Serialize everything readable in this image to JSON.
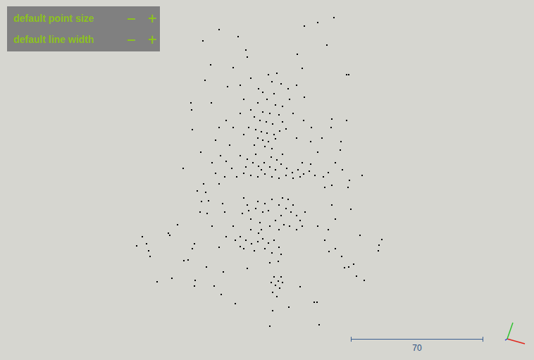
{
  "panel": {
    "rows": [
      {
        "label": "default point size",
        "decrease": "−",
        "increase": "+"
      },
      {
        "label": "default line width",
        "decrease": "−",
        "increase": "+"
      }
    ]
  },
  "scale_bar": {
    "label": "70"
  },
  "axes": [
    {
      "color": "#e0261c"
    },
    {
      "color": "#2fc22f"
    },
    {
      "color": "#2a40d0"
    }
  ],
  "point_cloud": {
    "points": [
      [
        473,
        24
      ],
      [
        450,
        31
      ],
      [
        431,
        36
      ],
      [
        310,
        41
      ],
      [
        337,
        51
      ],
      [
        287,
        57
      ],
      [
        463,
        63
      ],
      [
        348,
        70
      ],
      [
        421,
        76
      ],
      [
        350,
        80
      ],
      [
        491,
        105
      ],
      [
        494,
        105
      ],
      [
        270,
        145
      ],
      [
        271,
        155
      ],
      [
        272,
        183
      ],
      [
        259,
        238
      ],
      [
        193,
        348
      ],
      [
        201,
        335
      ],
      [
        207,
        345
      ],
      [
        210,
        355
      ],
      [
        212,
        363
      ],
      [
        222,
        399
      ],
      [
        243,
        394
      ],
      [
        238,
        330
      ],
      [
        251,
        318
      ],
      [
        240,
        333
      ],
      [
        275,
        345
      ],
      [
        272,
        352
      ],
      [
        260,
        369
      ],
      [
        266,
        368
      ],
      [
        276,
        397
      ],
      [
        275,
        405
      ],
      [
        292,
        378
      ],
      [
        303,
        405
      ],
      [
        313,
        417
      ],
      [
        316,
        385
      ],
      [
        333,
        430
      ],
      [
        382,
        462
      ],
      [
        452,
        460
      ],
      [
        445,
        428
      ],
      [
        449,
        428
      ],
      [
        425,
        406
      ],
      [
        409,
        435
      ],
      [
        386,
        440
      ],
      [
        536,
        355
      ],
      [
        541,
        339
      ],
      [
        537,
        347
      ],
      [
        516,
        397
      ],
      [
        505,
        391
      ],
      [
        494,
        378
      ],
      [
        501,
        374
      ],
      [
        488,
        379
      ],
      [
        484,
        363
      ],
      [
        475,
        352
      ],
      [
        466,
        356
      ],
      [
        510,
        333
      ],
      [
        513,
        248
      ],
      [
        497,
        296
      ],
      [
        493,
        265
      ],
      [
        491,
        170
      ],
      [
        470,
        168
      ],
      [
        483,
        200
      ],
      [
        482,
        212
      ],
      [
        469,
        180
      ],
      [
        456,
        195
      ],
      [
        428,
        96
      ],
      [
        431,
        137
      ],
      [
        441,
        180
      ],
      [
        298,
        91
      ],
      [
        330,
        95
      ],
      [
        322,
        122
      ],
      [
        290,
        113
      ],
      [
        299,
        145
      ],
      [
        305,
        198
      ],
      [
        284,
        215
      ],
      [
        288,
        260
      ],
      [
        291,
        272
      ],
      [
        295,
        284
      ],
      [
        293,
        302
      ],
      [
        279,
        270
      ],
      [
        285,
        285
      ],
      [
        283,
        300
      ],
      [
        315,
        288
      ],
      [
        318,
        300
      ],
      [
        333,
        340
      ],
      [
        340,
        349
      ],
      [
        350,
        380
      ],
      [
        382,
        372
      ],
      [
        394,
        370
      ],
      [
        398,
        360
      ],
      [
        380,
        105
      ],
      [
        392,
        103
      ],
      [
        385,
        115
      ],
      [
        398,
        118
      ],
      [
        366,
        125
      ],
      [
        372,
        130
      ],
      [
        388,
        132
      ],
      [
        378,
        140
      ],
      [
        365,
        145
      ],
      [
        390,
        148
      ],
      [
        400,
        150
      ],
      [
        355,
        155
      ],
      [
        372,
        158
      ],
      [
        382,
        160
      ],
      [
        395,
        162
      ],
      [
        360,
        165
      ],
      [
        368,
        170
      ],
      [
        377,
        172
      ],
      [
        386,
        175
      ],
      [
        400,
        172
      ],
      [
        352,
        180
      ],
      [
        362,
        183
      ],
      [
        370,
        186
      ],
      [
        378,
        188
      ],
      [
        388,
        190
      ],
      [
        396,
        185
      ],
      [
        405,
        182
      ],
      [
        365,
        195
      ],
      [
        372,
        198
      ],
      [
        380,
        200
      ],
      [
        390,
        196
      ],
      [
        360,
        205
      ],
      [
        375,
        207
      ],
      [
        385,
        210
      ],
      [
        345,
        140
      ],
      [
        340,
        160
      ],
      [
        410,
        140
      ],
      [
        415,
        160
      ],
      [
        345,
        190
      ],
      [
        420,
        195
      ],
      [
        340,
        220
      ],
      [
        350,
        225
      ],
      [
        358,
        230
      ],
      [
        366,
        235
      ],
      [
        374,
        230
      ],
      [
        382,
        236
      ],
      [
        390,
        240
      ],
      [
        398,
        232
      ],
      [
        406,
        238
      ],
      [
        414,
        244
      ],
      [
        422,
        240
      ],
      [
        430,
        246
      ],
      [
        438,
        242
      ],
      [
        446,
        248
      ],
      [
        345,
        245
      ],
      [
        355,
        248
      ],
      [
        365,
        250
      ],
      [
        375,
        246
      ],
      [
        385,
        250
      ],
      [
        395,
        252
      ],
      [
        405,
        248
      ],
      [
        415,
        252
      ],
      [
        425,
        250
      ],
      [
        335,
        250
      ],
      [
        328,
        238
      ],
      [
        320,
        228
      ],
      [
        312,
        220
      ],
      [
        458,
        250
      ],
      [
        465,
        244
      ],
      [
        362,
        218
      ],
      [
        384,
        222
      ],
      [
        400,
        218
      ],
      [
        370,
        240
      ],
      [
        392,
        226
      ],
      [
        348,
        236
      ],
      [
        428,
        230
      ],
      [
        440,
        232
      ],
      [
        318,
        250
      ],
      [
        310,
        260
      ],
      [
        470,
        262
      ],
      [
        460,
        265
      ],
      [
        365,
        285
      ],
      [
        375,
        288
      ],
      [
        385,
        282
      ],
      [
        395,
        290
      ],
      [
        405,
        295
      ],
      [
        412,
        300
      ],
      [
        420,
        305
      ],
      [
        398,
        305
      ],
      [
        390,
        312
      ],
      [
        402,
        318
      ],
      [
        410,
        320
      ],
      [
        380,
        298
      ],
      [
        372,
        300
      ],
      [
        362,
        295
      ],
      [
        352,
        298
      ],
      [
        343,
        302
      ],
      [
        355,
        310
      ],
      [
        368,
        315
      ],
      [
        382,
        320
      ],
      [
        395,
        325
      ],
      [
        425,
        312
      ],
      [
        432,
        300
      ],
      [
        415,
        290
      ],
      [
        408,
        282
      ],
      [
        400,
        280
      ],
      [
        350,
        290
      ],
      [
        345,
        280
      ],
      [
        420,
        325
      ],
      [
        428,
        320
      ],
      [
        340,
        335
      ],
      [
        348,
        340
      ],
      [
        356,
        345
      ],
      [
        365,
        342
      ],
      [
        372,
        338
      ],
      [
        380,
        344
      ],
      [
        388,
        340
      ],
      [
        345,
        352
      ],
      [
        360,
        355
      ],
      [
        375,
        352
      ],
      [
        385,
        358
      ],
      [
        395,
        350
      ],
      [
        366,
        330
      ],
      [
        355,
        325
      ],
      [
        370,
        325
      ],
      [
        388,
        392
      ],
      [
        394,
        398
      ],
      [
        390,
        404
      ],
      [
        396,
        408
      ],
      [
        386,
        414
      ],
      [
        392,
        420
      ],
      [
        400,
        400
      ],
      [
        384,
        400
      ],
      [
        398,
        392
      ],
      [
        320,
        170
      ],
      [
        330,
        180
      ],
      [
        310,
        180
      ],
      [
        325,
        205
      ],
      [
        300,
        230
      ],
      [
        305,
        245
      ],
      [
        440,
        200
      ],
      [
        450,
        215
      ],
      [
        430,
        170
      ],
      [
        420,
        120
      ],
      [
        340,
        120
      ],
      [
        355,
        110
      ],
      [
        408,
        125
      ],
      [
        470,
        290
      ],
      [
        475,
        310
      ],
      [
        465,
        325
      ],
      [
        460,
        340
      ],
      [
        450,
        320
      ],
      [
        330,
        320
      ],
      [
        320,
        335
      ],
      [
        310,
        350
      ],
      [
        300,
        320
      ],
      [
        475,
        230
      ],
      [
        485,
        240
      ],
      [
        495,
        255
      ]
    ]
  }
}
